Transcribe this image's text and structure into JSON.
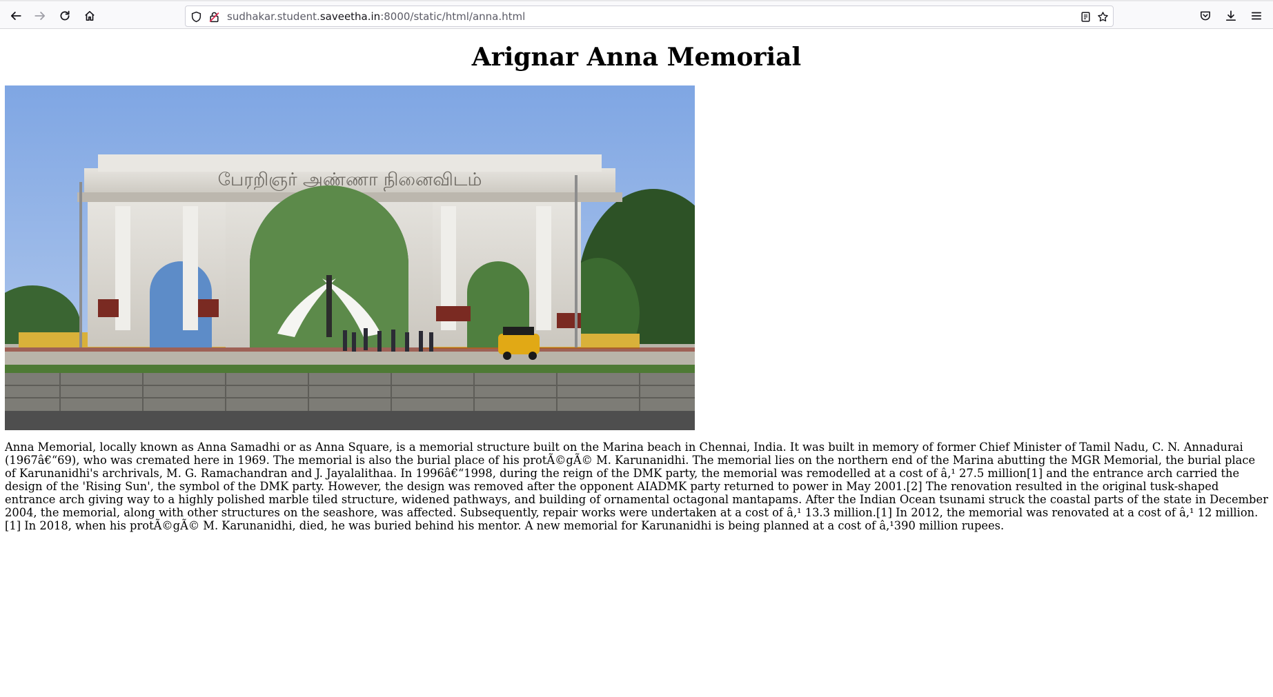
{
  "browser": {
    "url_prefix": "sudhakar.student.",
    "url_domain": "saveetha.in",
    "url_suffix": ":8000/static/html/anna.html",
    "icons": {
      "back": "back-arrow-icon",
      "forward": "forward-arrow-icon",
      "reload": "reload-icon",
      "home": "home-icon",
      "shield": "shield-icon",
      "lock": "lock-icon",
      "reader": "reader-view-icon",
      "bookmark": "bookmark-star-icon",
      "pocket": "pocket-icon",
      "downloads": "download-icon",
      "menu": "hamburger-menu-icon"
    }
  },
  "page": {
    "title": "Arignar Anna Memorial",
    "paragraph": "Anna Memorial, locally known as Anna Samadhi or as Anna Square, is a memorial structure built on the Marina beach in Chennai, India. It was built in memory of former Chief Minister of Tamil Nadu, C. N. Annadurai (1967â€“69), who was cremated here in 1969. The memorial is also the burial place of his protÃ©gÃ© M. Karunanidhi. The memorial lies on the northern end of the Marina abutting the MGR Memorial, the burial place of Karunanidhi's archrivals, M. G. Ramachandran and J. Jayalalithaa. In 1996â€“1998, during the reign of the DMK party, the memorial was remodelled at a cost of â‚¹ 27.5 million[1] and the entrance arch carried the design of the 'Rising Sun', the symbol of the DMK party. However, the design was removed after the opponent AIADMK party returned to power in May 2001.[2] The renovation resulted in the original tusk-shaped entrance arch giving way to a highly polished marble tiled structure, widened pathways, and building of ornamental octagonal mantapams. After the Indian Ocean tsunami struck the coastal parts of the state in December 2004, the memorial, along with other structures on the seashore, was affected. Subsequently, repair works were undertaken at a cost of â‚¹ 13.3 million.[1] In 2012, the memorial was renovated at a cost of â‚¹ 12 million.[1] In 2018, when his protÃ©gÃ© M. Karunanidhi, died, he was buried behind his mentor. A new memorial for Karunanidhi is being planned at a cost of â‚¹390 million rupees.",
    "arch_inscription": "பேரறிஞர் அண்ணா நினைவிடம்"
  },
  "colors": {
    "sky": "#8fb4e6",
    "marble": "#d9d6cf",
    "road": "#5a5a5a",
    "trees": "#2f5a2a"
  }
}
